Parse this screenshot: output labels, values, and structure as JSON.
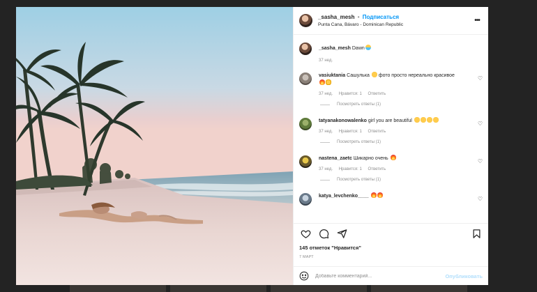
{
  "post": {
    "author": "_sasha_mesh",
    "follow_label": "Подписаться",
    "separator": "•",
    "location": "Punta Cana, Bávaro - Dominican Republic",
    "more_label": "•••"
  },
  "caption": {
    "username": "_sasha_mesh",
    "text": "Dawn",
    "emoji": [
      "mask"
    ],
    "time": "37 нед."
  },
  "comments": [
    {
      "username": "vasiuktania",
      "text": "Сашулька",
      "text2": "фото просто нереально красивое",
      "emoji_mid": [
        "heart-eyes"
      ],
      "emoji_end": [
        "fire",
        "clap"
      ],
      "time": "37 нед.",
      "likes": "Нравится: 1",
      "reply": "Ответить",
      "view_replies": "Посмотреть ответы (1)"
    },
    {
      "username": "tatyanakonowalenko",
      "text": "girl you are beautiful",
      "emoji_end": [
        "heart-eyes",
        "heart-eyes",
        "heart-eyes",
        "heart-eyes"
      ],
      "time": "37 нед.",
      "likes": "Нравится: 1",
      "reply": "Ответить",
      "view_replies": "Посмотреть ответы (1)"
    },
    {
      "username": "nastena_zaetc",
      "text": "Шикарно очень",
      "emoji_end": [
        "fire"
      ],
      "time": "37 нед.",
      "likes": "Нравится: 1",
      "reply": "Ответить",
      "view_replies": "Посмотреть ответы (1)"
    },
    {
      "username": "katya_levchenko____",
      "text": "",
      "emoji_end": [
        "fire",
        "fire"
      ]
    }
  ],
  "likes_text": "145 отметок \"Нравится\"",
  "date": "7 МАРТ",
  "add_comment": {
    "placeholder": "Добавьте комментарий...",
    "publish_label": "Опубликовать"
  },
  "icons": {
    "like": "heart-outline-icon",
    "comment": "comment-bubble-icon",
    "share": "paper-plane-icon",
    "save": "bookmark-icon",
    "emoji": "smiley-icon",
    "comment_like": "heart-small-icon"
  },
  "colors": {
    "link_blue": "#0095f6",
    "publish_disabled": "#b2dffc",
    "muted": "#8e8e8e",
    "text": "#262626"
  }
}
